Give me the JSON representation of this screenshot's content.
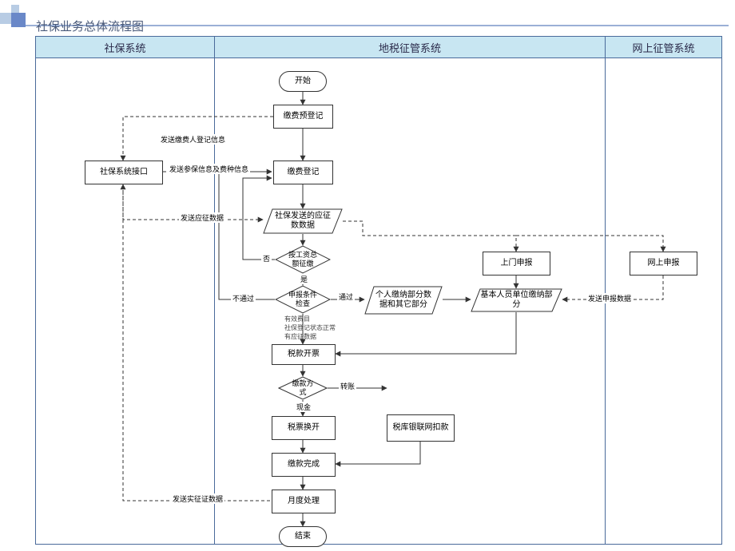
{
  "title": "社保业务总体流程图",
  "lanes": {
    "left": "社保系统",
    "mid": "地税征管系统",
    "right": "网上征管系统"
  },
  "nodes": {
    "start": "开始",
    "pre_reg": "缴费预登记",
    "sb_if": "社保系统接口",
    "reg": "缴费登记",
    "sent_data": "社保发送的应征数数据",
    "by_wage": "按工资总额征缴",
    "cond_check": "申报条件检查",
    "person_part": "个人缴纳部分数据和其它部分",
    "unit_part": "基本人员单位缴纳部分",
    "door_rpt": "上门申报",
    "online_rpt": "网上申报",
    "tax_bill": "税款开票",
    "pay_mode": "缴款方式",
    "bank_net": "税库银联网扣款",
    "swap_bill": "税票换开",
    "pay_done": "缴款完成",
    "month_proc": "月度处理",
    "end": "结束"
  },
  "edges": {
    "send_reg_info": "发送缴费人登记信息",
    "send_insure_info": "发送参保信息及费种信息",
    "send_levy": "发送应征数据",
    "no": "否",
    "yes": "是",
    "not_pass": "不通过",
    "pass": "通过",
    "cash": "现金",
    "transfer": "转账",
    "send_verify": "发送实征证数据",
    "send_rpt": "发送申报数据"
  },
  "cond_notes": {
    "l1": "有效费目",
    "l2": "社保登记状态正常",
    "l3": "有应征数据"
  }
}
